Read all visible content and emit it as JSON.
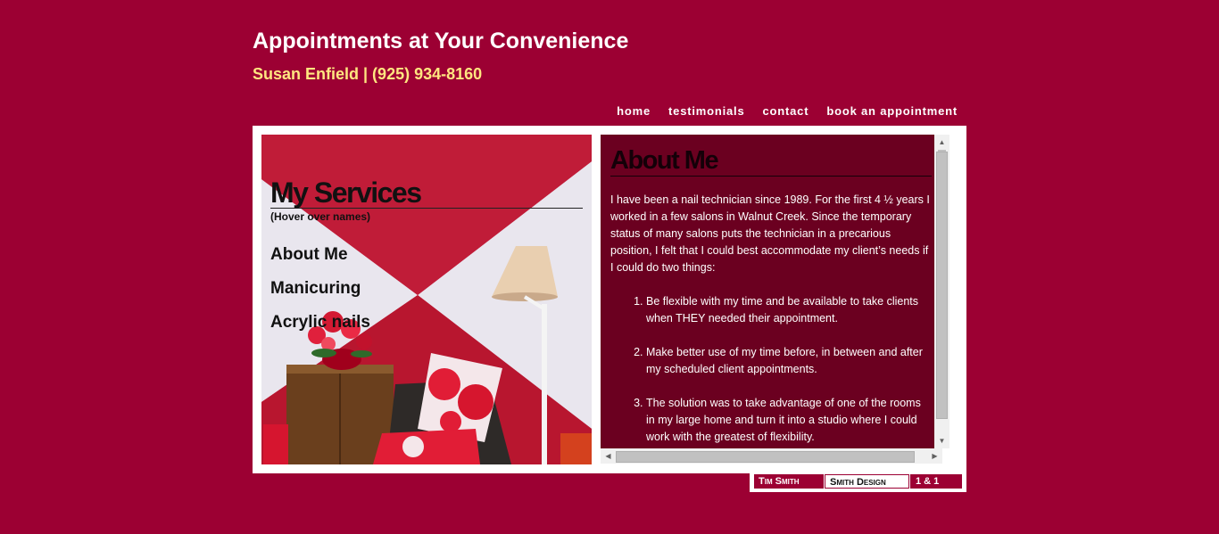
{
  "header": {
    "title": "Appointments at Your Convenience",
    "subtitle": "Susan Enfield | (925) 934-8160"
  },
  "nav": {
    "home": "home",
    "testimonials": "testimonials",
    "contact": "contact",
    "book": "book an appointment"
  },
  "services": {
    "title": "My Services",
    "hint": "(Hover over names)",
    "items": [
      "About Me",
      "Manicuring",
      "Acrylic nails"
    ]
  },
  "about": {
    "title": "About Me",
    "intro": "I have been a nail technician since 1989. For the first 4 ½ years I worked in a few salons in Walnut Creek. Since the temporary status of many salons puts the technician in a precarious position, I felt that I could best accommodate my client’s needs if I could do two things:",
    "points": [
      "Be flexible with my time and be available to take clients when THEY needed their appointment.",
      "Make better use of my time before, in between and after my scheduled client appointments.",
      "The solution was to take advantage of one of the rooms in my large home and turn it into a studio where I could work with the greatest of flexibility."
    ]
  },
  "credit": {
    "author": "Tim Smith",
    "company": "Smith Design",
    "tag": "1 & 1"
  },
  "colors": {
    "background": "#9c0033",
    "subtitle": "#ffe680",
    "content_panel": "#6b0020"
  },
  "icons": {
    "scroll_up": "▲",
    "scroll_down": "▼",
    "scroll_left": "◀",
    "scroll_right": "▶"
  }
}
